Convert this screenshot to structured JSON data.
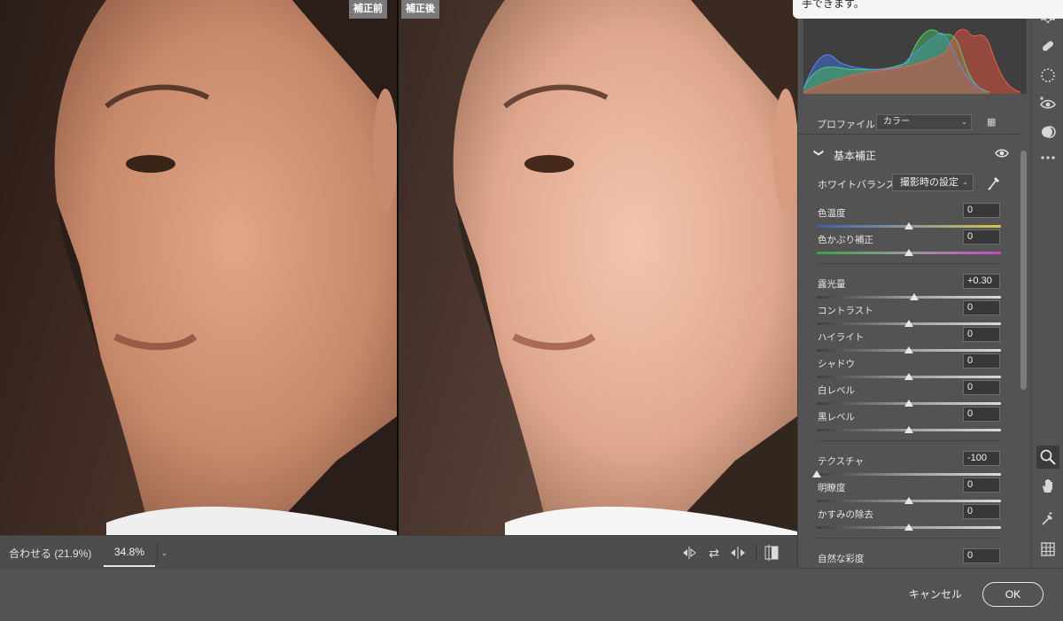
{
  "tooltip": {
    "text": "手できます。"
  },
  "preview": {
    "before_label": "補正前",
    "after_label": "補正後"
  },
  "zoom": {
    "fit_label": "合わせる (21.9%)",
    "value": "34.8%"
  },
  "preview_icons": [
    "swap-before-after-icon",
    "copy-settings-icon",
    "toggle-split-icon",
    "before-after-view-icon"
  ],
  "profile": {
    "label": "プロファイル",
    "value": "カラー"
  },
  "section": {
    "title": "基本補正"
  },
  "white_balance": {
    "label": "ホワイトバランス",
    "value": "撮影時の設定"
  },
  "sliders": [
    {
      "label": "色温度",
      "value": "0",
      "level": 0.5,
      "track": "temp"
    },
    {
      "label": "色かぶり補正",
      "value": "0",
      "level": 0.5,
      "track": "tint"
    },
    {
      "label": "露光量",
      "value": "+0.30",
      "level": 0.53,
      "track": "gray"
    },
    {
      "label": "コントラスト",
      "value": "0",
      "level": 0.5,
      "track": "gray"
    },
    {
      "label": "ハイライト",
      "value": "0",
      "level": 0.5,
      "track": "gray"
    },
    {
      "label": "シャドウ",
      "value": "0",
      "level": 0.5,
      "track": "gray"
    },
    {
      "label": "白レベル",
      "value": "0",
      "level": 0.5,
      "track": "gray"
    },
    {
      "label": "黒レベル",
      "value": "0",
      "level": 0.5,
      "track": "gray"
    },
    {
      "label": "テクスチャ",
      "value": "-100",
      "level": 0.0,
      "track": "gray"
    },
    {
      "label": "明瞭度",
      "value": "0",
      "level": 0.5,
      "track": "gray"
    },
    {
      "label": "かすみの除去",
      "value": "0",
      "level": 0.5,
      "track": "gray"
    },
    {
      "label": "自然な彩度",
      "value": "0",
      "level": 0.5,
      "track": "vib"
    }
  ],
  "tools": [
    "crop-icon",
    "healing-brush-icon",
    "radial-filter-icon",
    "red-eye-icon",
    "masking-icon",
    "more-icon",
    "zoom-icon",
    "hand-icon",
    "color-sampler-icon",
    "grid-icon"
  ],
  "footer": {
    "cancel_label": "キャンセル",
    "ok_label": "OK"
  }
}
